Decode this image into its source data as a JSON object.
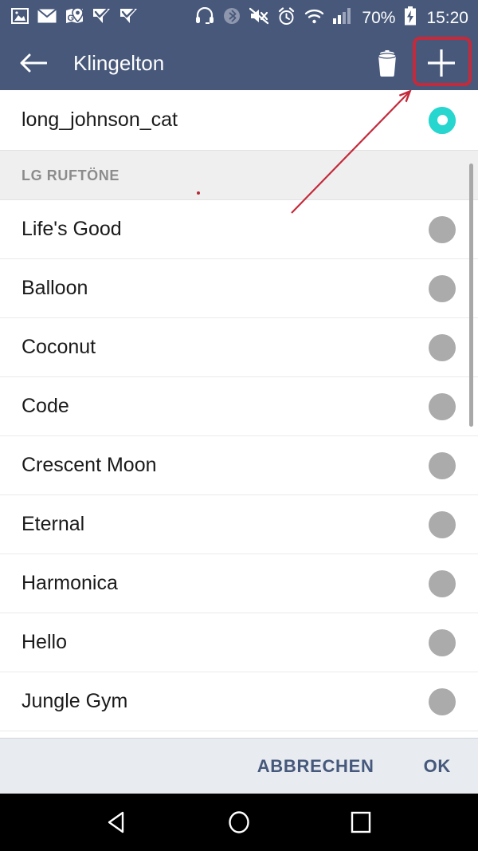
{
  "status_bar": {
    "left_icons": [
      "gallery-icon",
      "email-icon",
      "maps-pin-icon",
      "check-flag-icon",
      "check-flag-icon"
    ],
    "right_icons": [
      "headset-icon",
      "bluetooth-icon",
      "mute-icon",
      "alarm-icon",
      "wifi-icon",
      "signal-icon"
    ],
    "battery_percent": "70%",
    "battery_icon": "battery-charging-icon",
    "clock": "15:20",
    "background_color": "#47587A"
  },
  "app_bar": {
    "back_label": "back-arrow",
    "title": "Klingelton",
    "delete_label": "trash-icon",
    "add_label": "plus-icon",
    "background_color": "#47587A"
  },
  "annotation": {
    "highlight_color": "#C32B3C",
    "arrow_color": "#C32B3C",
    "target": "plus-icon"
  },
  "list": {
    "current": {
      "label": "long_johnson_cat",
      "selected": true
    },
    "section": {
      "header": "LG RUFTÖNE"
    },
    "items": [
      {
        "label": "Life's Good",
        "selected": false
      },
      {
        "label": "Balloon",
        "selected": false
      },
      {
        "label": "Coconut",
        "selected": false
      },
      {
        "label": "Code",
        "selected": false
      },
      {
        "label": "Crescent Moon",
        "selected": false
      },
      {
        "label": "Eternal",
        "selected": false
      },
      {
        "label": "Harmonica",
        "selected": false
      },
      {
        "label": "Hello",
        "selected": false
      },
      {
        "label": "Jungle Gym",
        "selected": false
      }
    ],
    "selected_color": "#27D6CE",
    "unselected_color": "#ABABAB"
  },
  "action_bar": {
    "cancel_label": "ABBRECHEN",
    "ok_label": "OK",
    "text_color": "#46587B",
    "background_color": "#E8EBF0"
  },
  "nav_bar": {
    "back_label": "nav-back-icon",
    "home_label": "nav-home-icon",
    "recents_label": "nav-recents-icon"
  }
}
